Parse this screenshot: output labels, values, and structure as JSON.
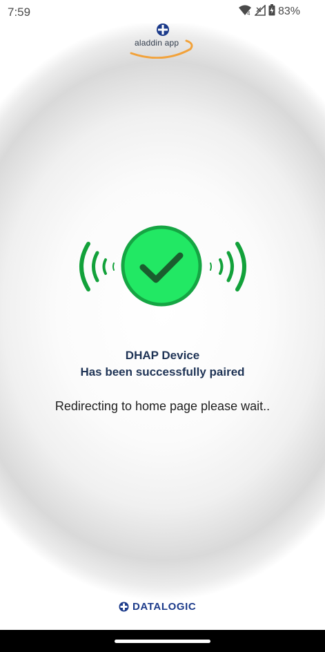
{
  "status_bar": {
    "time": "7:59",
    "signal_label": "4",
    "battery_percent": "83%",
    "icons": [
      "wifi-icon",
      "cell-signal-icon",
      "battery-icon"
    ]
  },
  "header": {
    "logo_text": "aladdin app"
  },
  "pairing": {
    "device_name": "DHAP Device",
    "paired_message": "Has been successfully paired",
    "redirect_message": "Redirecting to home page please wait..",
    "icons": [
      "check-icon",
      "signal-waves-left-icon",
      "signal-waves-right-icon"
    ]
  },
  "footer": {
    "brand": "DATALOGIC"
  },
  "colors": {
    "success_green": "#22e864",
    "wave_green": "#12a13a",
    "check_dark": "#1a5d2e",
    "text_navy": "#1e3355",
    "brand_blue": "#1b3a8a",
    "logo_orange": "#f2a23a"
  }
}
